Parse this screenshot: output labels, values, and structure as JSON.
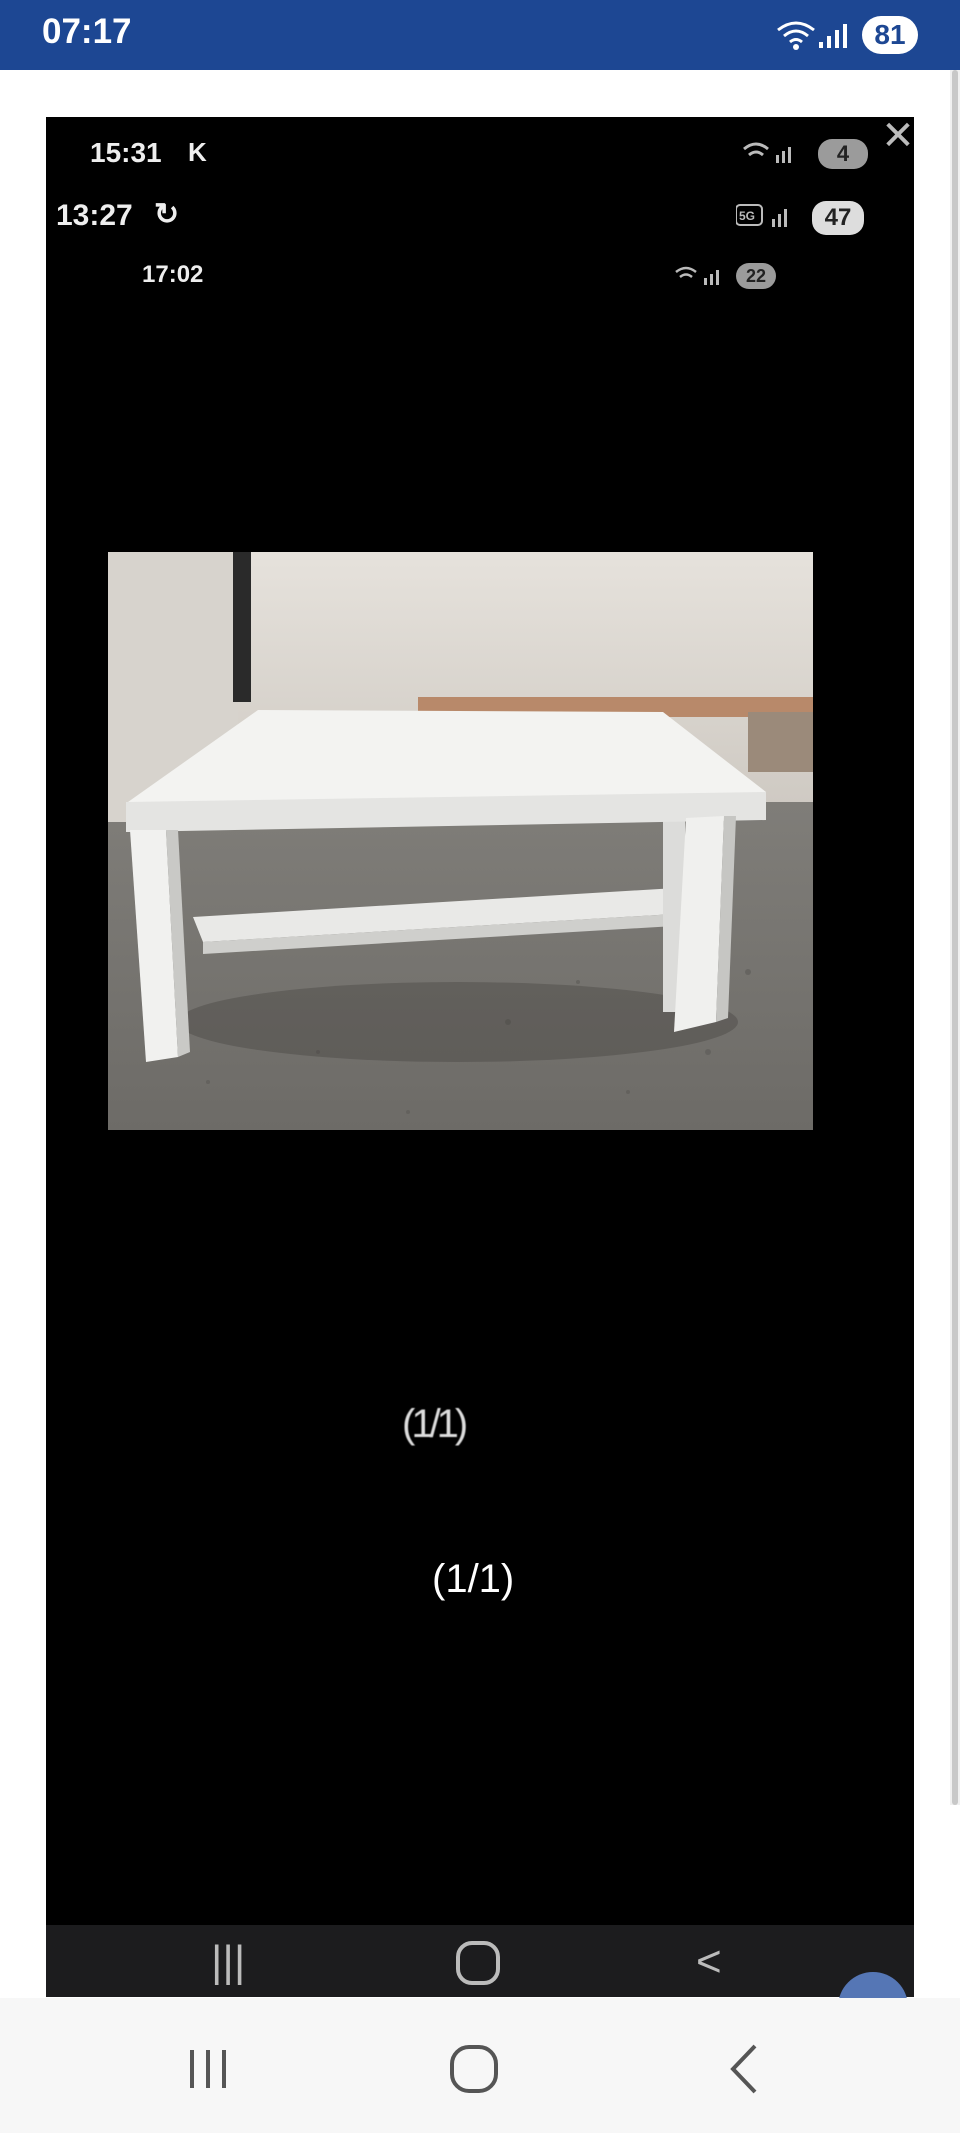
{
  "status_bar": {
    "time": "07:17",
    "battery": "81"
  },
  "viewer": {
    "nested_status": [
      {
        "time": "15:31",
        "extra": "K",
        "badge": "4"
      },
      {
        "time": "13:27",
        "extra": "",
        "badge": "47"
      },
      {
        "time": "17:02",
        "extra": "",
        "badge": "22"
      }
    ],
    "ghost_counter": "(1/1)",
    "counter": "(1/1)"
  },
  "icons": {
    "close": "close-icon",
    "wifi": "wifi-icon",
    "signal": "signal-icon",
    "recents": "recents-icon",
    "home": "home-icon",
    "back": "back-icon"
  }
}
